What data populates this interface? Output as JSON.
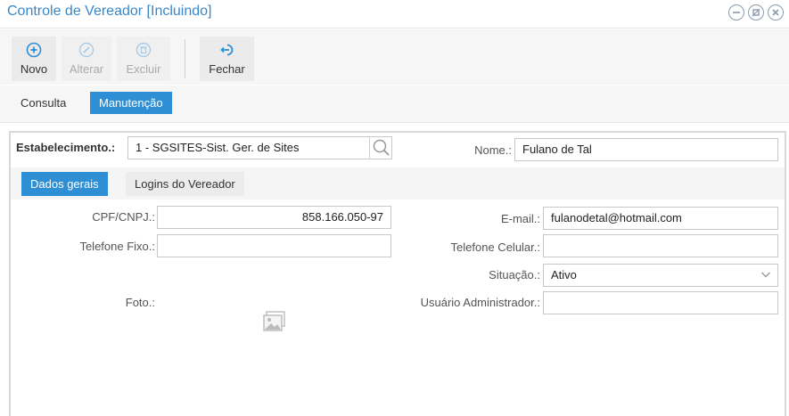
{
  "window": {
    "title": "Controle de Vereador [Incluindo]",
    "controls": [
      "minimize-icon",
      "restore-icon",
      "close-icon"
    ]
  },
  "toolbar": {
    "buttons": [
      {
        "label": "Novo",
        "icon": "plus-circle-icon",
        "enabled": true
      },
      {
        "label": "Alterar",
        "icon": "pencil-icon",
        "enabled": false
      },
      {
        "label": "Excluir",
        "icon": "trash-icon",
        "enabled": false
      },
      {
        "label": "Fechar",
        "icon": "exit-icon",
        "enabled": true
      }
    ]
  },
  "tabs": {
    "items": [
      {
        "label": "Consulta",
        "active": false
      },
      {
        "label": "Manutenção",
        "active": true
      }
    ]
  },
  "header_fields": {
    "estabelecimento_label": "Estabelecimento.:",
    "estabelecimento_value": "1 - SGSITES-Sist. Ger. de Sites",
    "nome_label": "Nome.:",
    "nome_value": "Fulano de Tal"
  },
  "inner_tabs": {
    "items": [
      {
        "label": "Dados gerais",
        "active": true
      },
      {
        "label": "Logins do Vereador",
        "active": false
      }
    ]
  },
  "form": {
    "cpf_label": "CPF/CNPJ.:",
    "cpf_value": "858.166.050-97",
    "telefone_fixo_label": "Telefone Fixo.:",
    "telefone_fixo_value": "",
    "foto_label": "Foto.:",
    "email_label": "E-mail.:",
    "email_value": "fulanodetal@hotmail.com",
    "telefone_celular_label": "Telefone Celular.:",
    "telefone_celular_value": "",
    "situacao_label": "Situação.:",
    "situacao_value": "Ativo",
    "usuario_admin_label": "Usuário Administrador.:",
    "usuario_admin_value": ""
  },
  "colors": {
    "accent": "#2f8fd4",
    "title": "#3a87c8"
  }
}
